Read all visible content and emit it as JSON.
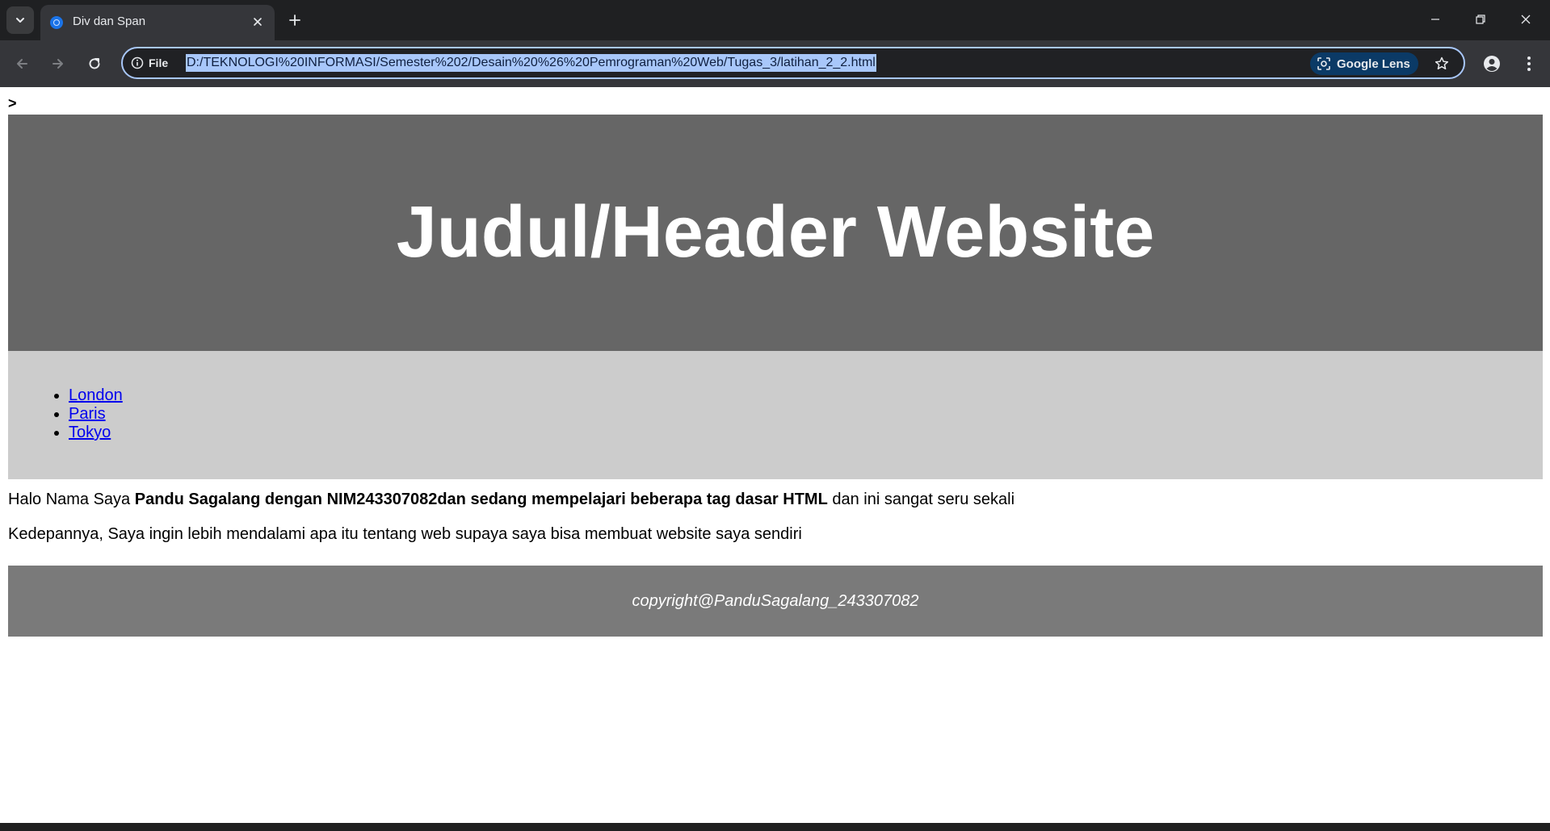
{
  "browser": {
    "tab_title": "Div dan Span",
    "site_info_label": "File",
    "url": "D:/TEKNOLOGI%20INFORMASI/Semester%202/Desain%20%26%20Pemrograman%20Web/Tugas_3/latihan_2_2.html",
    "lens_label": "Google Lens"
  },
  "page": {
    "stray_text": ">",
    "header_title": "Judul/Header Website",
    "nav_links": [
      "London",
      "Paris",
      "Tokyo"
    ],
    "paragraph1": {
      "prefix": "Halo Nama Saya ",
      "bold": "Pandu Sagalang dengan NIM243307082dan sedang mempelajari beberapa tag dasar HTML",
      "suffix": " dan ini sangat seru sekali"
    },
    "paragraph2": "Kedepannya, Saya ingin lebih mendalami apa itu tentang web supaya saya bisa membuat website saya sendiri",
    "footer": "copyright@PanduSagalang_243307082"
  },
  "colors": {
    "header_bg": "#666666",
    "nav_bg": "#cccccc",
    "footer_bg": "#7a7a7a",
    "omnibox_focus": "#a8c7fa"
  }
}
